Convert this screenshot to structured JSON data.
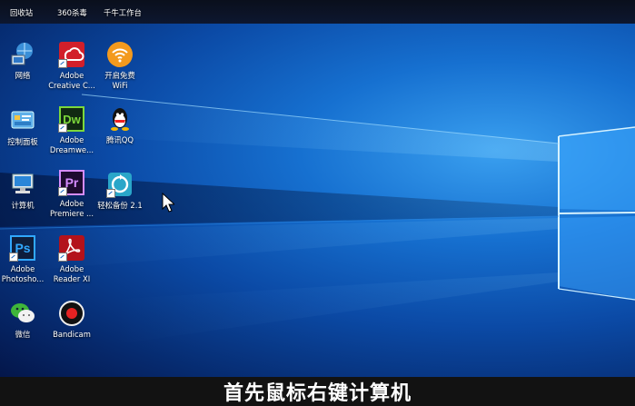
{
  "top_labels": [
    "回收站",
    "360杀毒",
    "千牛工作台"
  ],
  "icons": [
    {
      "name": "network-icon",
      "label1": "网络",
      "label2": ""
    },
    {
      "name": "adobe-cc-icon",
      "label1": "Adobe",
      "label2": "Creative C..."
    },
    {
      "name": "wifi-icon",
      "label1": "开启免费",
      "label2": "WiFi"
    },
    {
      "name": "control-panel-icon",
      "label1": "控制面板",
      "label2": ""
    },
    {
      "name": "dreamweaver-icon",
      "label1": "Adobe",
      "label2": "Dreamwe..."
    },
    {
      "name": "qq-icon",
      "label1": "腾讯QQ",
      "label2": ""
    },
    {
      "name": "computer-icon",
      "label1": "计算机",
      "label2": ""
    },
    {
      "name": "premiere-icon",
      "label1": "Adobe",
      "label2": "Premiere ..."
    },
    {
      "name": "backup-icon",
      "label1": "轻松备份 2.1",
      "label2": ""
    },
    {
      "name": "photoshop-icon",
      "label1": "Adobe",
      "label2": "Photosho..."
    },
    {
      "name": "acrobat-icon",
      "label1": "Adobe",
      "label2": "Reader XI"
    },
    {
      "name": "wechat-icon",
      "label1": "微信",
      "label2": ""
    },
    {
      "name": "bandicam-icon",
      "label1": "Bandicam",
      "label2": ""
    }
  ],
  "icon_glyphs": {
    "dw": "Dw",
    "pr": "Pr",
    "ps": "Ps"
  },
  "caption": "首先鼠标右键计算机"
}
